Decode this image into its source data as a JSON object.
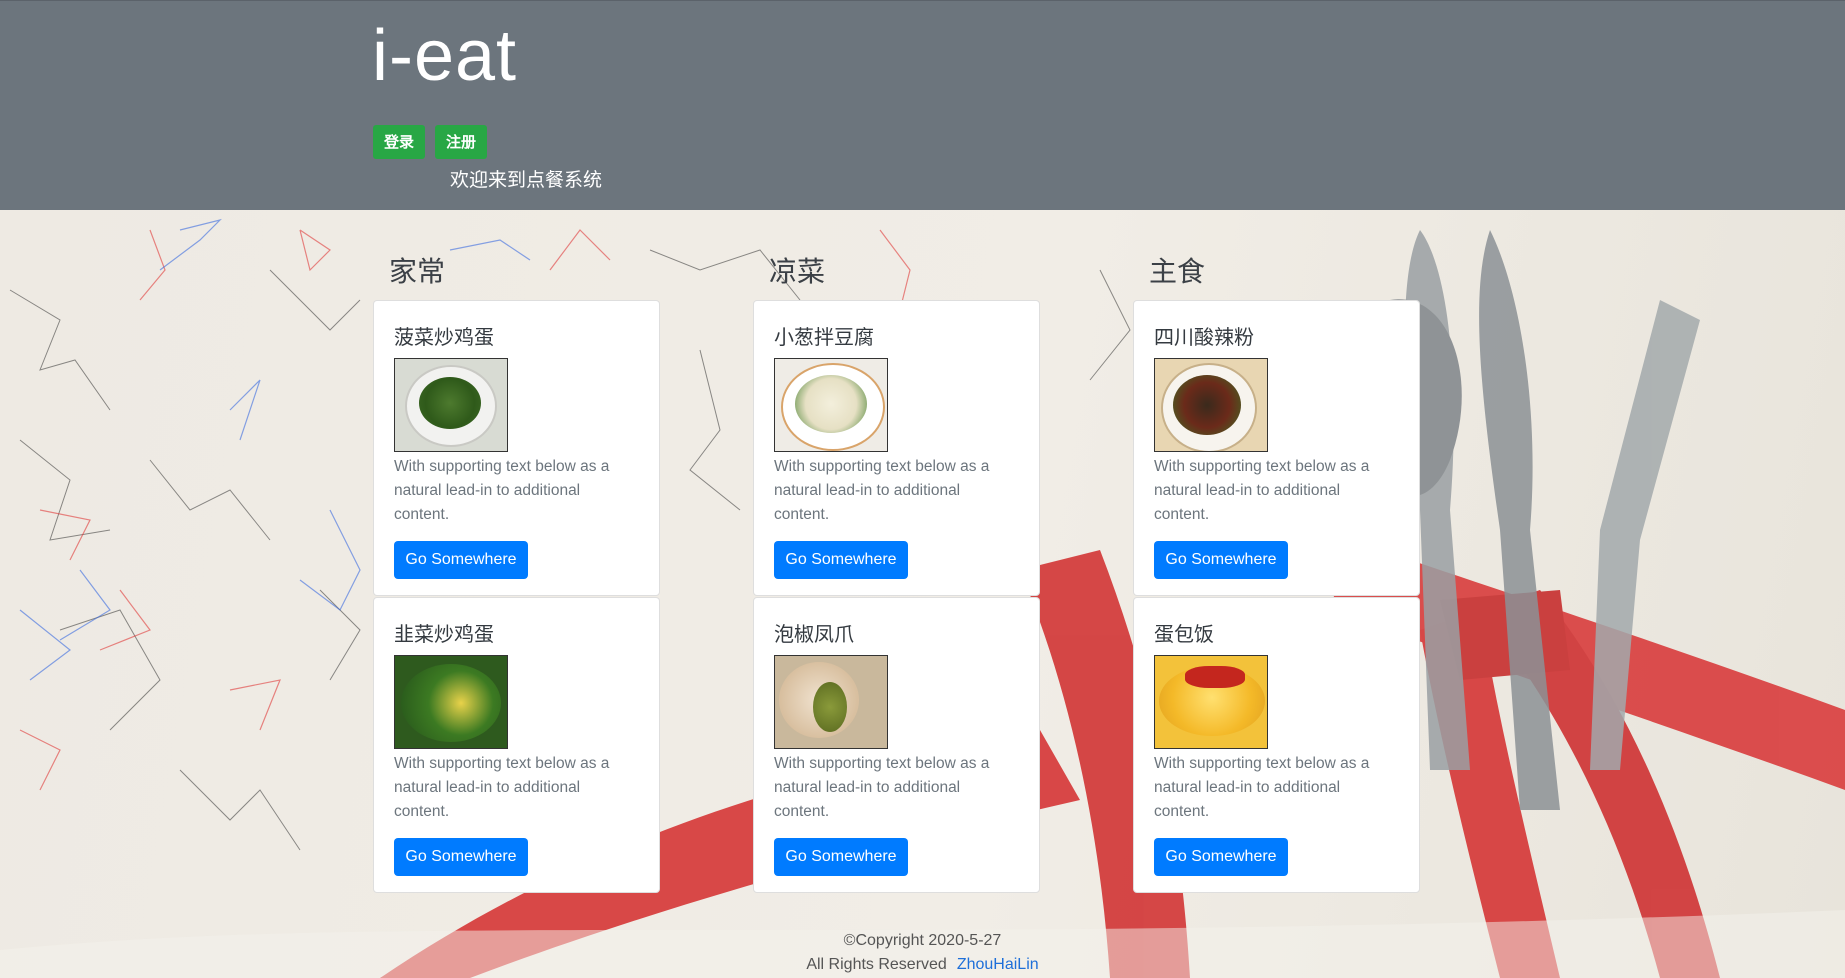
{
  "header": {
    "brand": "i-eat",
    "login_label": "登录",
    "register_label": "注册",
    "welcome": "欢迎来到点餐系统"
  },
  "categories": [
    {
      "title": "家常",
      "dishes": [
        {
          "name": "菠菜炒鸡蛋",
          "text": "With supporting text below as a natural lead-in to additional content.",
          "button": "Go Somewhere"
        },
        {
          "name": "韭菜炒鸡蛋",
          "text": "With supporting text below as a natural lead-in to additional content.",
          "button": "Go Somewhere"
        }
      ]
    },
    {
      "title": "凉菜",
      "dishes": [
        {
          "name": "小葱拌豆腐",
          "text": "With supporting text below as a natural lead-in to additional content.",
          "button": "Go Somewhere"
        },
        {
          "name": "泡椒凤爪",
          "text": "With supporting text below as a natural lead-in to additional content.",
          "button": "Go Somewhere"
        }
      ]
    },
    {
      "title": "主食",
      "dishes": [
        {
          "name": "四川酸辣粉",
          "text": "With supporting text below as a natural lead-in to additional content.",
          "button": "Go Somewhere"
        },
        {
          "name": "蛋包饭",
          "text": "With supporting text below as a natural lead-in to additional content.",
          "button": "Go Somewhere"
        }
      ]
    }
  ],
  "footer": {
    "copyright": "©Copyright  2020-5-27",
    "rights": "All Rights Reserved",
    "author": "ZhouHaiLin"
  },
  "colors": {
    "header_bg": "#6c757d",
    "success": "#28a745",
    "primary": "#007bff"
  }
}
